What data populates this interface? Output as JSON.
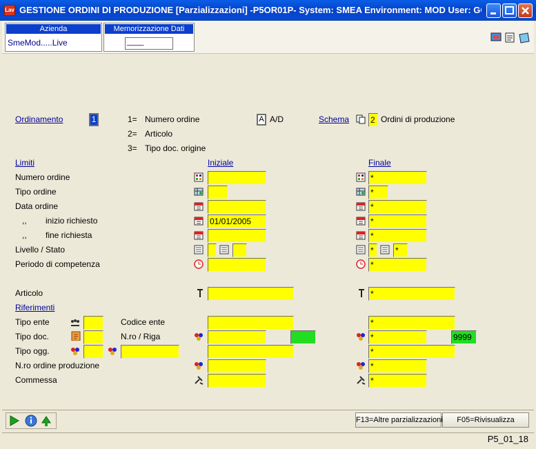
{
  "window": {
    "title": "GESTIONE ORDINI DI PRODUZIONE [Parzializzazioni] -P5OR01P- System: SMEA Environment: MOD User: GC ...",
    "app_icon_text": "Lav",
    "minimize_icon": "minimize-icon",
    "maximize_icon": "maximize-icon",
    "close_icon": "close-icon"
  },
  "header": {
    "azienda_title": "Azienda",
    "azienda_value": "SmeMod.....Live",
    "memo_title": "Memorizzazione Dati Video",
    "memo_value": "____"
  },
  "ordinamento": {
    "label": "Ordinamento",
    "value": "1",
    "options": [
      "1=",
      "Numero ordine",
      "2=",
      "Articolo",
      "3=",
      "Tipo doc. origine"
    ],
    "ad_value": "A",
    "ad_label": "A/D"
  },
  "schema": {
    "label": "Schema",
    "value": "2",
    "text": "Ordini di produzione"
  },
  "columns": {
    "limiti": "Limiti",
    "iniziale": "Iniziale",
    "finale": "Finale"
  },
  "rows": {
    "numero_ordine": {
      "label": "Numero ordine",
      "ini": "",
      "fin": "*"
    },
    "tipo_ordine": {
      "label": "Tipo ordine",
      "ini": "",
      "fin": "*"
    },
    "data_ordine": {
      "label": "Data ordine",
      "ini": "",
      "fin": "*"
    },
    "inizio_richiesto": {
      "label": "inizio richiesto",
      "prefix": ",,",
      "ini": "01/01/2005",
      "fin": "*"
    },
    "fine_richiesta": {
      "label": "fine richiesta",
      "prefix": ",,",
      "ini": "",
      "fin": "*"
    },
    "livello_stato": {
      "label": "Livello / Stato",
      "ini1": "",
      "ini2": "",
      "fin1": "*",
      "fin2": "*"
    },
    "periodo": {
      "label": "Periodo di competenza",
      "ini": "",
      "fin": "*"
    },
    "articolo": {
      "label": "Articolo",
      "ini": "",
      "fin": "*"
    }
  },
  "riferimenti": {
    "label": "Riferimenti",
    "tipo_ente": {
      "label": "Tipo ente",
      "value": ""
    },
    "codice_ente": {
      "label": "Codice ente",
      "ini": "",
      "fin": "*"
    },
    "tipo_doc": {
      "label": "Tipo doc.",
      "value": ""
    },
    "nro_riga": {
      "label": "N.ro / Riga",
      "ini": "",
      "ini_riga": "",
      "fin": "*",
      "fin_riga": "9999"
    },
    "tipo_ogg": {
      "label": "Tipo ogg.",
      "value": "",
      "value2": "",
      "fin": "*"
    },
    "nro_ordine_produzione": {
      "label": "N.ro ordine produzione",
      "ini": "",
      "fin": "*"
    },
    "commessa": {
      "label": "Commessa",
      "ini": "",
      "fin": "*"
    }
  },
  "bottom": {
    "f13": "F13=Altre parzializzazioni",
    "f05": "F05=Rivisualizza",
    "status": "P5_01_18"
  },
  "colors": {
    "field_bg": "#FFFF00",
    "green_field": "#22DD22",
    "titlebar": "#0543C9",
    "link": "#0000A0"
  }
}
